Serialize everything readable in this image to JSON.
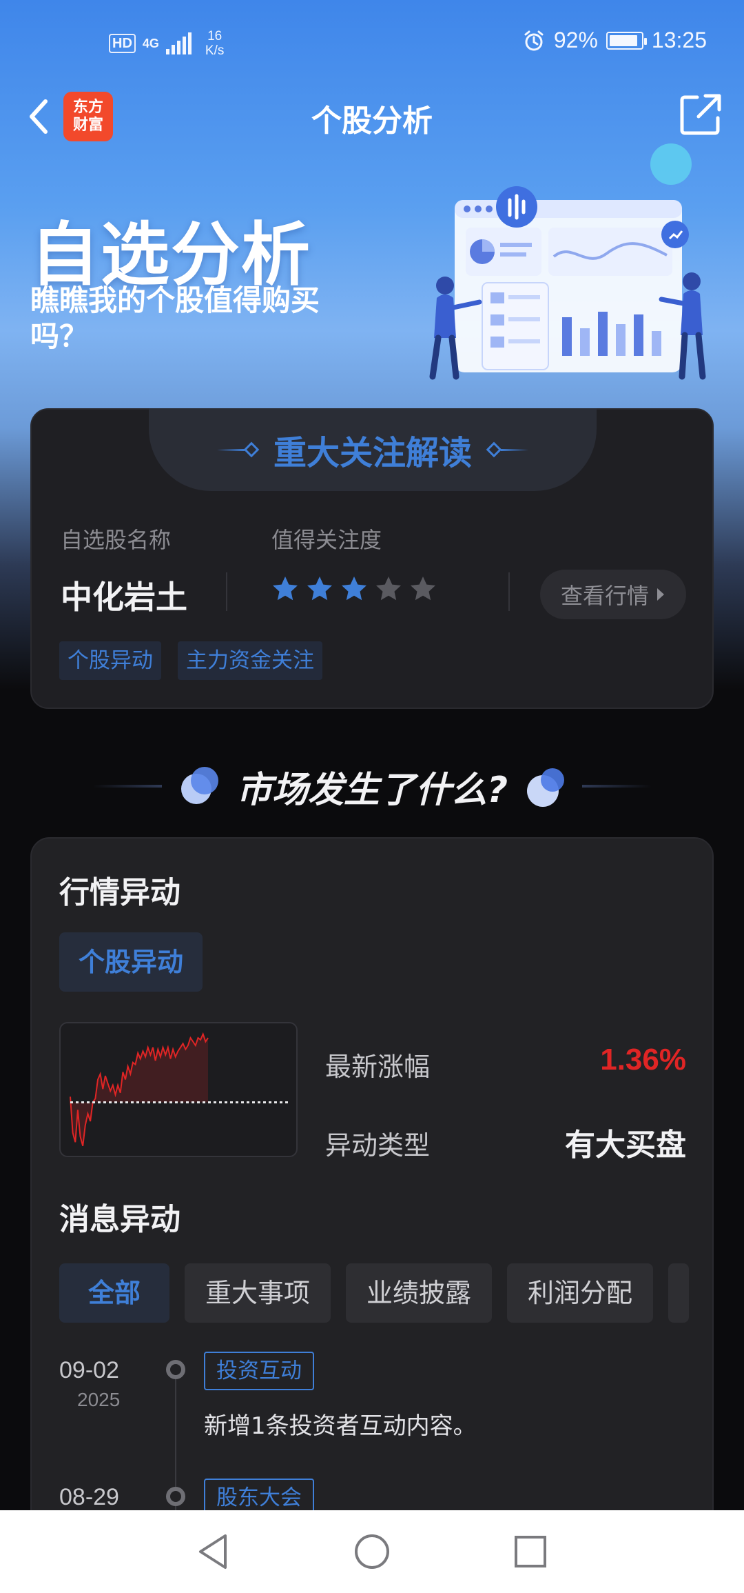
{
  "status_bar": {
    "hd": "HD",
    "network": "4G",
    "speed_value": "16",
    "speed_unit": "K/s",
    "battery": "92%",
    "battery_level": 0.92,
    "time": "13:25"
  },
  "header": {
    "logo_text": "东方财富",
    "logo_line1": "东方",
    "logo_line2": "财富",
    "title": "个股分析",
    "back_icon": "chevron-left-icon",
    "share_icon": "share-icon"
  },
  "banner": {
    "title": "自选分析",
    "subtitle": "瞧瞧我的个股值得购买吗？"
  },
  "focus_card": {
    "title": "重大关注解读",
    "stock_name_label": "自选股名称",
    "attention_label": "值得关注度",
    "stock_name": "中化岩土",
    "rating": 3,
    "rating_max": 5,
    "view_button": "查看行情",
    "tags": [
      "个股异动",
      "主力资金关注"
    ]
  },
  "section_title": "市场发生了什么?",
  "market_card": {
    "title": "行情异动",
    "tag": "个股异动",
    "latest_change_label": "最新涨幅",
    "latest_change_value": "1.36%",
    "anomaly_type_label": "异动类型",
    "anomaly_type_value": "有大买盘",
    "news_title": "消息异动",
    "filters": [
      "全部",
      "重大事项",
      "业绩披露",
      "利润分配",
      ""
    ],
    "active_filter": "全部",
    "timeline": [
      {
        "date": "09-02",
        "year": "2025",
        "tag": "投资互动",
        "text": "新增1条投资者互动内容。"
      },
      {
        "date": "08-29",
        "year": "",
        "tag": "股东大会",
        "text": ""
      }
    ]
  },
  "colors": {
    "accent_blue": "#3f7fd8",
    "up_red": "#e02525",
    "card_bg": "#222225",
    "star_on": "#3f7fd8",
    "star_off": "#5a5a60"
  },
  "intraday_chart": {
    "type": "line",
    "baseline_pct": 0.0,
    "values_pct": [
      0.3,
      -1.6,
      -2.1,
      -0.4,
      -1.8,
      -2.3,
      -1.2,
      -0.6,
      -1.0,
      0.0,
      0.2,
      1.2,
      1.5,
      0.7,
      1.4,
      1.0,
      0.6,
      0.9,
      0.4,
      0.9,
      0.5,
      1.6,
      1.2,
      1.9,
      1.5,
      2.1,
      2.0,
      2.6,
      2.3,
      2.7,
      2.4,
      2.9,
      2.5,
      2.9,
      2.2,
      2.8,
      2.4,
      2.9,
      2.5,
      2.9,
      2.3,
      2.8,
      2.4,
      2.7,
      2.9,
      3.1,
      2.8,
      3.0,
      3.4,
      3.2,
      3.0,
      3.4,
      3.3,
      3.6,
      3.2,
      3.4
    ]
  }
}
